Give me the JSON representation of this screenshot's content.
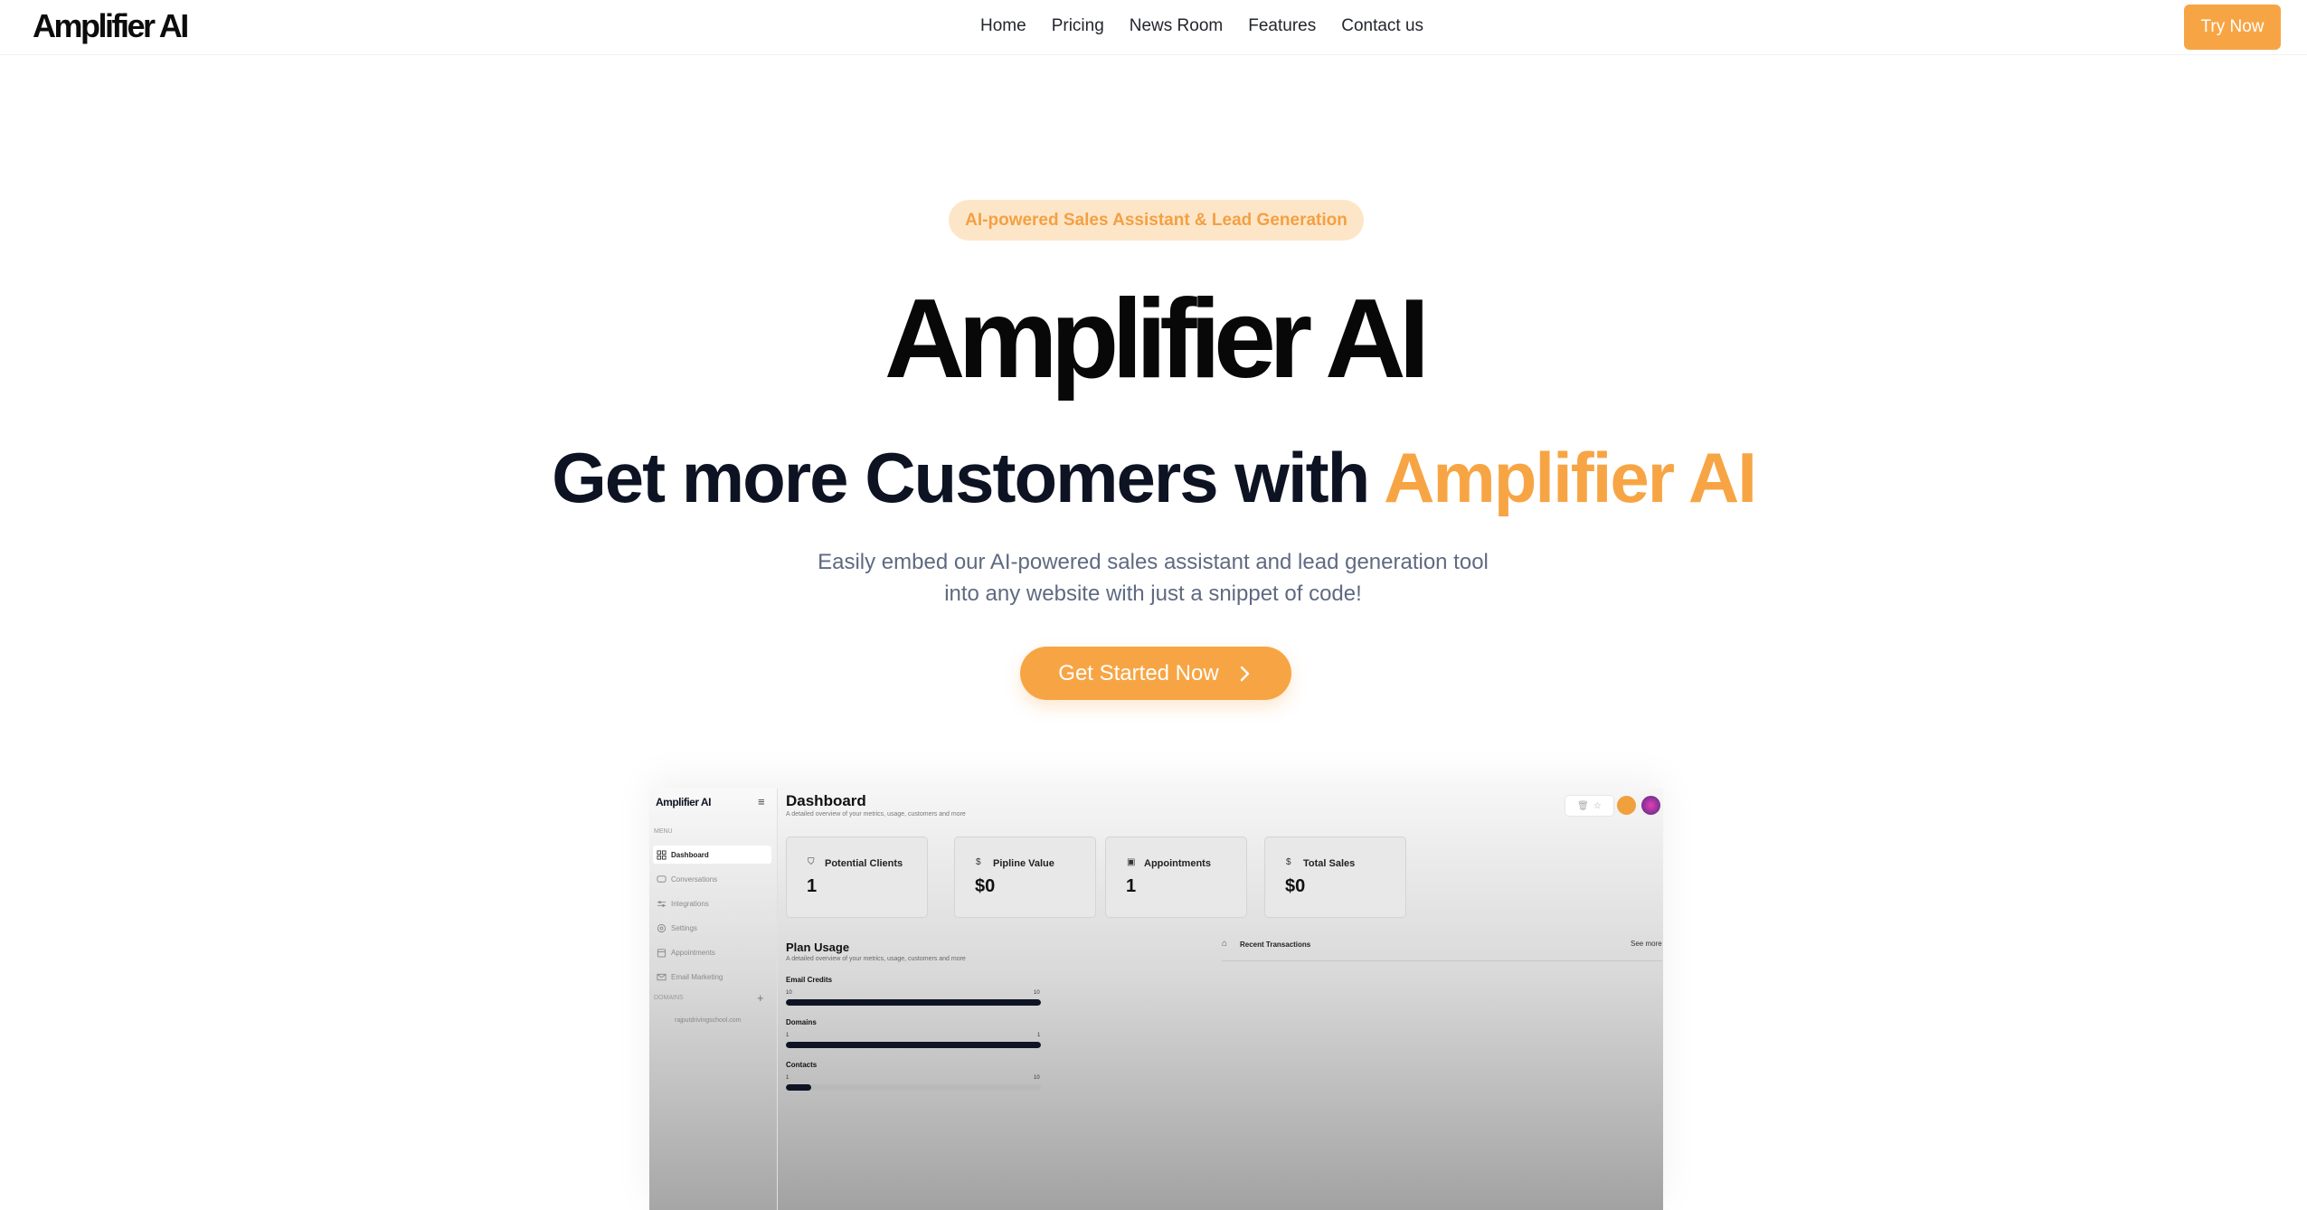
{
  "nav": {
    "logo": "Amplifier AI",
    "links": [
      "Home",
      "Pricing",
      "News Room",
      "Features",
      "Contact us"
    ],
    "try_now": "Try Now"
  },
  "hero": {
    "pill": "AI-powered Sales Assistant & Lead Generation",
    "logo": "Amplifier AI",
    "headline_main": "Get more Customers with ",
    "headline_accent": "Amplifier AI",
    "subtext_line1": "Easily embed our AI-powered sales assistant and lead generation tool",
    "subtext_line2": "into any website with just a snippet of code!",
    "cta": "Get Started Now"
  },
  "preview": {
    "logo": "Amplifier AI",
    "menu_label": "MENU",
    "nav_items": [
      "Dashboard",
      "Conversations",
      "Integrations",
      "Settings",
      "Appointments",
      "Email Marketing"
    ],
    "domains_label": "DOMAINS",
    "domain": "rajputdrivingschool.com",
    "title": "Dashboard",
    "subtitle": "A detailed overview of your metrics, usage, customers and more",
    "cards": [
      {
        "label": "Potential Clients",
        "value": "1",
        "icon": "clients-icon"
      },
      {
        "label": "Pipline Value",
        "value": "$0",
        "icon": "dollar-icon"
      },
      {
        "label": "Appointments",
        "value": "1",
        "icon": "calendar-icon"
      },
      {
        "label": "Total Sales",
        "value": "$0",
        "icon": "dollar-icon"
      }
    ],
    "plan_usage_title": "Plan Usage",
    "plan_usage_sub": "A detailed overview of your metrics, usage, customers and more",
    "usage": [
      {
        "label": "Email Credits",
        "used": "10",
        "total": "10",
        "fraction": 1.0
      },
      {
        "label": "Domains",
        "used": "1",
        "total": "1",
        "fraction": 1.0
      },
      {
        "label": "Contacts",
        "used": "1",
        "total": "10",
        "fraction": 0.1
      }
    ],
    "recent_transactions": "Recent Transactions",
    "see_more": "See more"
  },
  "colors": {
    "accent": "#f7a544",
    "pill_bg": "#fde6c8",
    "text_dark": "#0d1322",
    "text_muted": "#5f6a81"
  }
}
